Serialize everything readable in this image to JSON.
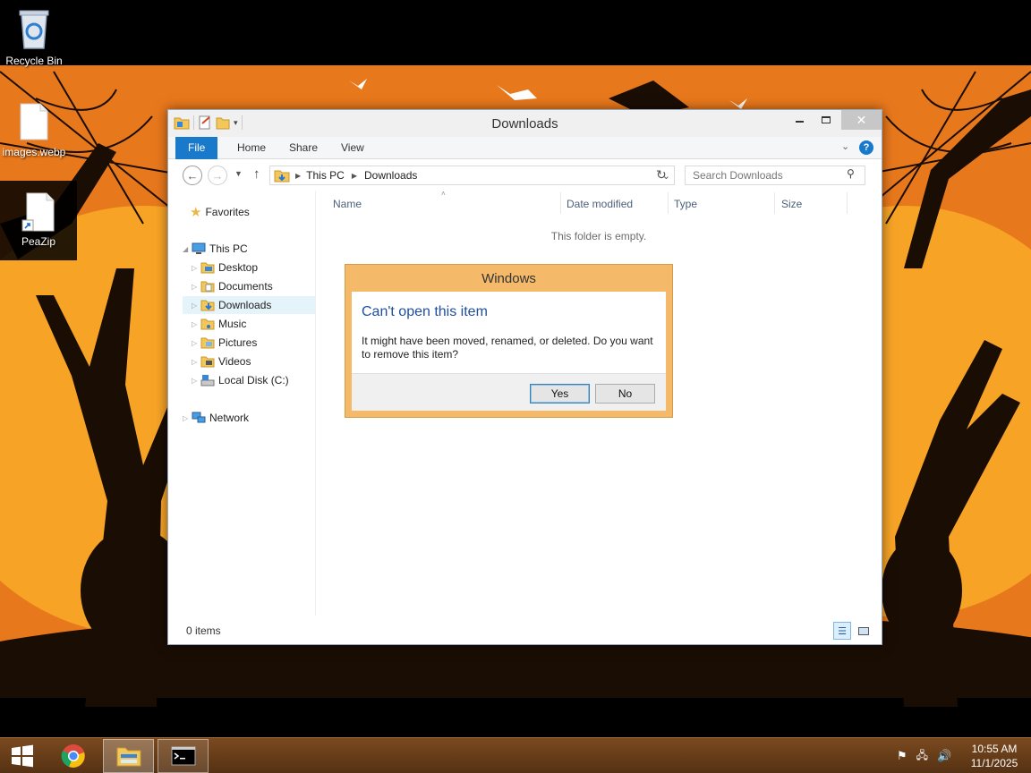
{
  "desktop": {
    "icons": [
      {
        "label": "Recycle Bin",
        "icon": "recycle-bin-icon"
      },
      {
        "label": "images.webp",
        "icon": "file-icon"
      },
      {
        "label": "PeaZip",
        "icon": "shortcut-file-icon"
      }
    ]
  },
  "explorer": {
    "title": "Downloads",
    "ribbon_tabs": [
      "File",
      "Home",
      "Share",
      "View"
    ],
    "breadcrumbs": [
      "This PC",
      "Downloads"
    ],
    "search_placeholder": "Search Downloads",
    "nav": {
      "favorites": "Favorites",
      "this_pc": "This PC",
      "this_pc_children": [
        "Desktop",
        "Documents",
        "Downloads",
        "Music",
        "Pictures",
        "Videos",
        "Local Disk (C:)"
      ],
      "network": "Network",
      "selected": "Downloads"
    },
    "columns": [
      "Name",
      "Date modified",
      "Type",
      "Size"
    ],
    "empty_message": "This folder is empty.",
    "status": "0 items"
  },
  "dialog": {
    "title": "Windows",
    "heading": "Can't open this item",
    "message": "It might have been moved, renamed, or deleted. Do you want to remove this item?",
    "yes_label": "Yes",
    "no_label": "No"
  },
  "taskbar": {
    "items": [
      "start-button",
      "chrome-app",
      "file-explorer-app",
      "command-prompt-app"
    ],
    "clock_time": "10:55 AM",
    "clock_date": "11/1/2025"
  },
  "colors": {
    "accent": "#1979ca",
    "dialog_border": "#f4b969",
    "taskbar": "#6a3f1a",
    "wallpaper_orange": "#e8781c"
  }
}
